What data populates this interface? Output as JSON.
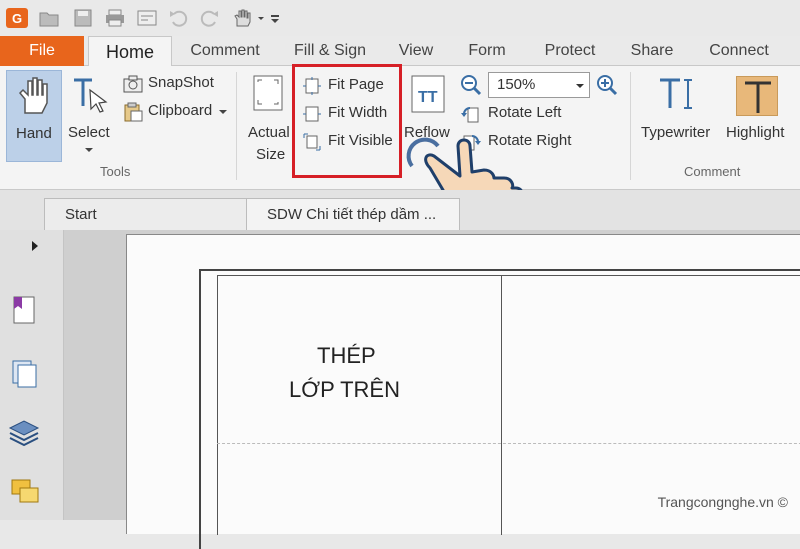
{
  "quick_access": {
    "icons": [
      "app-logo-icon",
      "open-icon",
      "save-icon",
      "print-icon",
      "window-icon",
      "undo-icon",
      "redo-icon",
      "hand-dropdown-icon",
      "customize-icon"
    ]
  },
  "tabs": [
    "File",
    "Home",
    "Comment",
    "Fill & Sign",
    "View",
    "Form",
    "Protect",
    "Share",
    "Connect"
  ],
  "tools_group": {
    "hand": "Hand",
    "select": "Select",
    "snapshot": "SnapShot",
    "clipboard": "Clipboard",
    "label": "Tools"
  },
  "view_group": {
    "actual_size_1": "Actual",
    "actual_size_2": "Size",
    "fit_page": "Fit Page",
    "fit_width": "Fit Width",
    "fit_visible": "Fit Visible",
    "reflow": "Reflow",
    "zoom": "150%",
    "rotate_left": "Rotate Left",
    "rotate_right": "Rotate Right"
  },
  "comment_group": {
    "typewriter": "Typewriter",
    "highlight": "Highlight",
    "label": "Comment"
  },
  "document_tabs": [
    "Start",
    "SDW Chi tiết thép dầm ..."
  ],
  "document": {
    "line1": "THÉP",
    "line2": "LỚP TRÊN"
  },
  "watermark": "Trangcongnghe.vn ©",
  "colors": {
    "file_tab": "#e8651c",
    "highlight_box": "#d61f26",
    "accent_blue": "#3a6ea5"
  }
}
